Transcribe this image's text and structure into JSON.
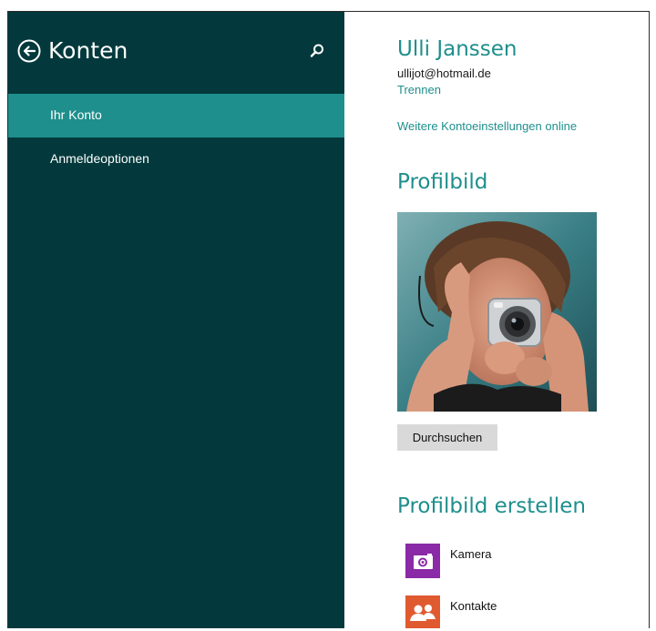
{
  "sidebar": {
    "title": "Konten",
    "items": [
      {
        "label": "Ihr Konto",
        "active": true
      },
      {
        "label": "Anmeldeoptionen",
        "active": false
      }
    ]
  },
  "account": {
    "name": "Ulli Janssen",
    "email": "ullijot@hotmail.de",
    "disconnect_label": "Trennen",
    "more_settings_label": "Weitere Kontoeinstellungen online"
  },
  "profile_picture": {
    "title": "Profilbild",
    "browse_label": "Durchsuchen"
  },
  "create_picture": {
    "title": "Profilbild erstellen",
    "apps": [
      {
        "label": "Kamera",
        "icon": "camera-icon",
        "color": "#8a2aa7"
      },
      {
        "label": "Kontakte",
        "icon": "people-icon",
        "color": "#e05a30"
      }
    ]
  },
  "colors": {
    "sidebar_bg": "#03393c",
    "accent": "#1e8f8c"
  }
}
